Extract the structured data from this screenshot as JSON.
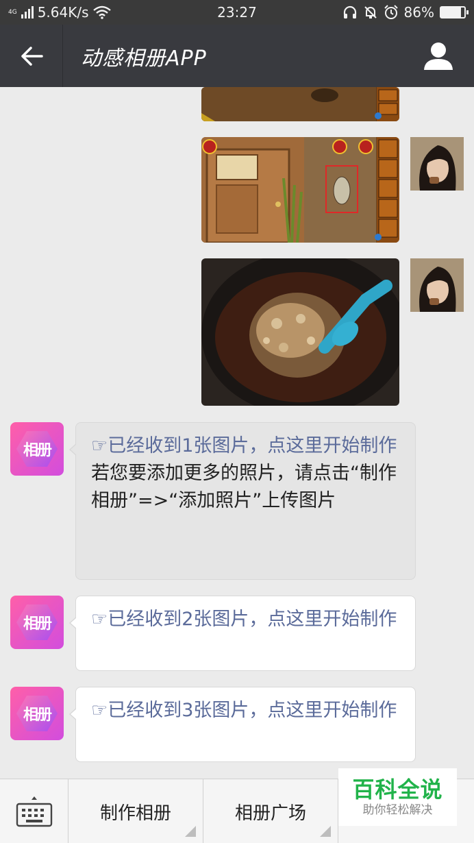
{
  "status_bar": {
    "network_type": "4G",
    "speed": "5.64K/s",
    "time": "23:27",
    "battery": "86%",
    "battery_level": 0.86,
    "icons": [
      "signal-icon",
      "wifi-icon",
      "headset-icon",
      "mute-icon",
      "alarm-icon",
      "battery-icon"
    ]
  },
  "header": {
    "title": "动感相册APP",
    "back_icon": "arrow-left-icon",
    "profile_icon": "user-icon"
  },
  "messages": [
    {
      "type": "image",
      "from": "user",
      "description": "game screenshot (cropped top)"
    },
    {
      "type": "image",
      "from": "user",
      "description": "game screenshot with door"
    },
    {
      "type": "image",
      "from": "user",
      "description": "chocolate walnut photo"
    },
    {
      "type": "text",
      "from": "app",
      "avatar_text": "相册",
      "link_line": "☞已经收到1张图片，点这里开始制作",
      "extra_line": "若您要添加更多的照片，请点击“制作相册”=>“添加照片”上传图片"
    },
    {
      "type": "text",
      "from": "app",
      "avatar_text": "相册",
      "link_line": "☞已经收到2张图片，点这里开始制作"
    },
    {
      "type": "text",
      "from": "app",
      "avatar_text": "相册",
      "link_line": "☞已经收到3张图片，点这里开始制作"
    }
  ],
  "bottom_menu": {
    "keyboard_icon": "keyboard-icon",
    "items": [
      {
        "label": "制作相册"
      },
      {
        "label": "相册广场"
      }
    ]
  },
  "watermark": {
    "title": "百科全说",
    "subtitle": "助你轻松解决"
  },
  "colors": {
    "header_bg": "#393a3f",
    "chat_bg": "#ebebeb",
    "link_text": "#5b6b9a",
    "watermark_green": "#21b34a",
    "app_avatar": "#e04fc8"
  }
}
